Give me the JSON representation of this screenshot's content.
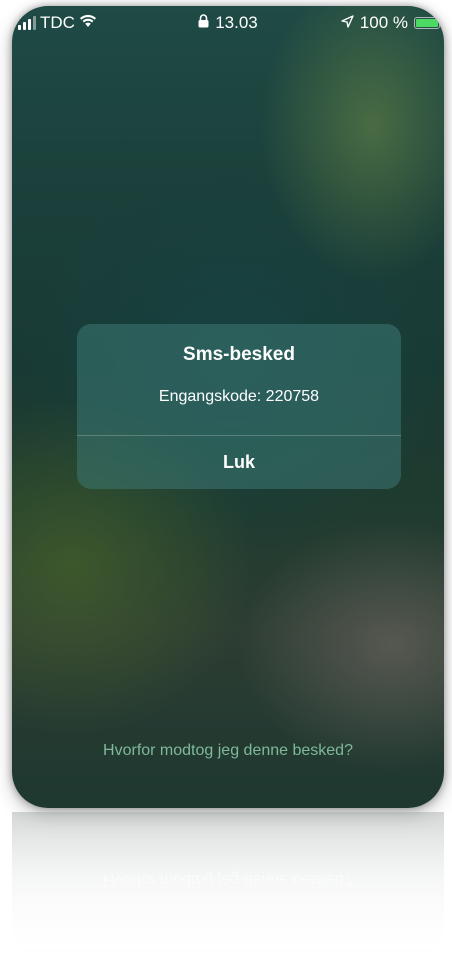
{
  "status_bar": {
    "carrier": "TDC",
    "time": "13.03",
    "battery": "100 %",
    "battery_level": 1.0,
    "battery_color": "#4cd964",
    "icons": [
      "signal-icon",
      "wifi-icon",
      "lock-icon",
      "location-icon",
      "battery-icon"
    ]
  },
  "alert": {
    "title": "Sms-besked",
    "message": "Engangskode: 220758",
    "button_label": "Luk"
  },
  "help_link": "Hvorfor modtog jeg denne besked?",
  "colors": {
    "link": "#7fb89a",
    "background": "#1b3f3a"
  }
}
